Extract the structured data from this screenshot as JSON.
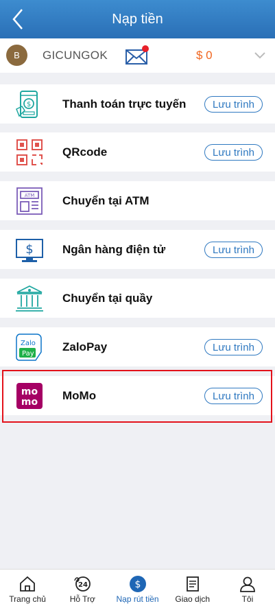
{
  "header": {
    "title": "Nạp tiền"
  },
  "user": {
    "avatar_letter": "B",
    "name": "GICUNGOK",
    "balance": "$ 0"
  },
  "methods": [
    {
      "label": "Thanh toán trực tuyến",
      "button": "Lưu trình",
      "icon": "mobile-payment-icon"
    },
    {
      "label": "QRcode",
      "button": "Lưu trình",
      "icon": "qr-code-icon"
    },
    {
      "label": "Chuyển tại ATM",
      "button": "",
      "icon": "atm-icon"
    },
    {
      "label": "Ngân hàng điện tử",
      "button": "Lưu trình",
      "icon": "online-banking-icon"
    },
    {
      "label": "Chuyển tại quầy",
      "button": "",
      "icon": "bank-counter-icon"
    },
    {
      "label": "ZaloPay",
      "button": "Lưu trình",
      "icon": "zalopay-icon",
      "logo_text": [
        "Zalo",
        "Pay"
      ]
    },
    {
      "label": "MoMo",
      "button": "Lưu trình",
      "icon": "momo-icon",
      "logo_text": [
        "mo",
        "mo"
      ]
    }
  ],
  "tabs": [
    {
      "label": "Trang chủ",
      "icon": "home-icon"
    },
    {
      "label": "Hỗ Trợ",
      "icon": "support-24-icon",
      "badge": "24"
    },
    {
      "label": "Nạp rút tiền",
      "icon": "dollar-icon",
      "active": true
    },
    {
      "label": "Giao dịch",
      "icon": "document-icon"
    },
    {
      "label": "Tôi",
      "icon": "user-icon"
    }
  ],
  "colors": {
    "header": "#2a6fb6",
    "accent": "#2e78c0",
    "balance": "#f0651e",
    "highlight": "#e3111a",
    "icon_teal": "#1fa7a0"
  }
}
